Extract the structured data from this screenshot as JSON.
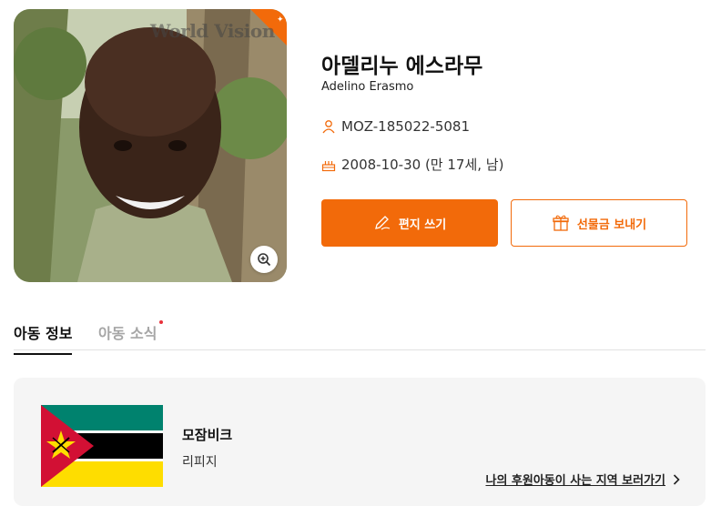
{
  "child": {
    "name_ko": "아델리누 에스라무",
    "name_en": "Adelino Erasmo",
    "child_id": "MOZ-185022-5081",
    "birth": "2008-10-30 (만 17세, 남)",
    "watermark": "World Vision"
  },
  "actions": {
    "letter_label": "편지 쓰기",
    "gift_label": "선물금 보내기"
  },
  "tabs": [
    {
      "label": "아동 정보",
      "active": true
    },
    {
      "label": "아동 소식",
      "active": false,
      "has_new_dot": true
    }
  ],
  "location": {
    "country": "모잠비크",
    "region": "리피지",
    "link_label": "나의 후원아동이 사는 지역 보러가기"
  },
  "icons": {
    "id": "person-icon",
    "birth": "cake-icon",
    "letter": "pen-icon",
    "gift": "gift-icon",
    "zoom": "zoom-in-icon",
    "link": "chevron-right-icon"
  },
  "colors": {
    "accent": "#f26a0a",
    "tab_active": "#111111",
    "tab_inactive": "#a6a6a6",
    "new_dot": "#e8313b"
  }
}
